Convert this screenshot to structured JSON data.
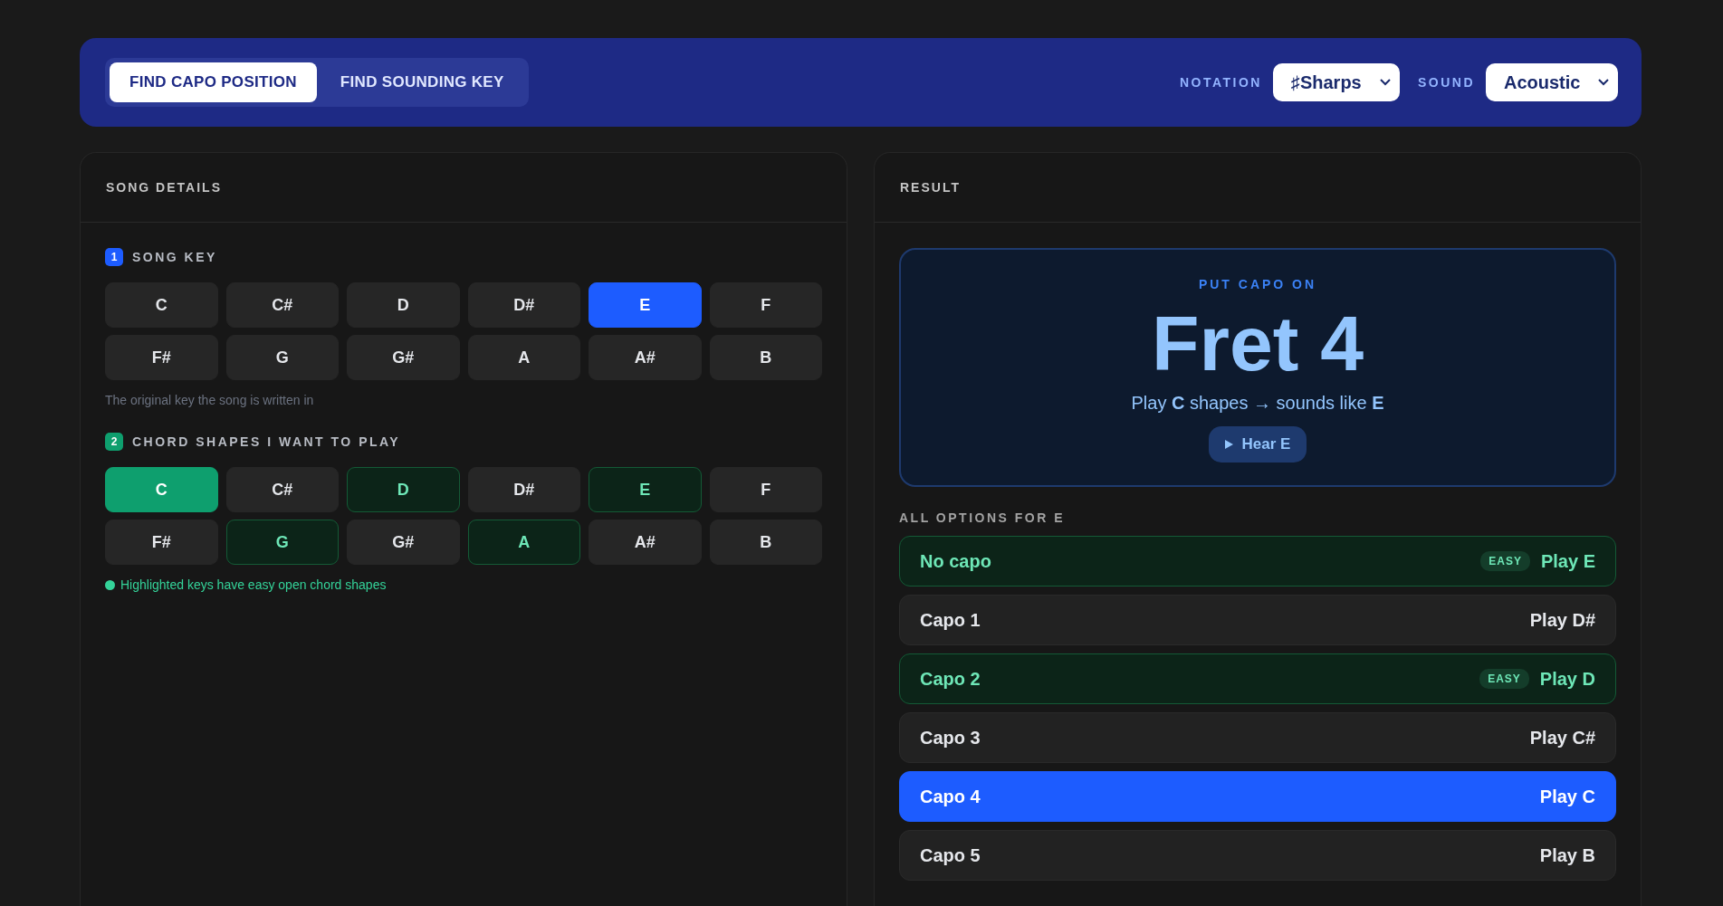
{
  "mode_tabs": [
    {
      "label": "FIND CAPO POSITION",
      "selected": true
    },
    {
      "label": "FIND SOUNDING KEY",
      "selected": false
    }
  ],
  "notation": {
    "label": "NOTATION",
    "value": "♯Sharps"
  },
  "sound": {
    "label": "SOUND",
    "value": "Acoustic"
  },
  "song_details": {
    "title": "SONG DETAILS",
    "song_key": {
      "step": "1",
      "label": "SONG KEY",
      "hint": "The original key the song is written in",
      "keys": [
        {
          "label": "C",
          "selected": false
        },
        {
          "label": "C#",
          "selected": false
        },
        {
          "label": "D",
          "selected": false
        },
        {
          "label": "D#",
          "selected": false
        },
        {
          "label": "E",
          "selected": true
        },
        {
          "label": "F",
          "selected": false
        },
        {
          "label": "F#",
          "selected": false
        },
        {
          "label": "G",
          "selected": false
        },
        {
          "label": "G#",
          "selected": false
        },
        {
          "label": "A",
          "selected": false
        },
        {
          "label": "A#",
          "selected": false
        },
        {
          "label": "B",
          "selected": false
        }
      ]
    },
    "chord_shapes": {
      "step": "2",
      "label": "CHORD SHAPES I WANT TO PLAY",
      "legend": "Highlighted keys have easy open chord shapes",
      "keys": [
        {
          "label": "C",
          "selected": true,
          "easy": true
        },
        {
          "label": "C#",
          "selected": false,
          "easy": false
        },
        {
          "label": "D",
          "selected": false,
          "easy": true
        },
        {
          "label": "D#",
          "selected": false,
          "easy": false
        },
        {
          "label": "E",
          "selected": false,
          "easy": true
        },
        {
          "label": "F",
          "selected": false,
          "easy": false
        },
        {
          "label": "F#",
          "selected": false,
          "easy": false
        },
        {
          "label": "G",
          "selected": false,
          "easy": true
        },
        {
          "label": "G#",
          "selected": false,
          "easy": false
        },
        {
          "label": "A",
          "selected": false,
          "easy": true
        },
        {
          "label": "A#",
          "selected": false,
          "easy": false
        },
        {
          "label": "B",
          "selected": false,
          "easy": false
        }
      ]
    }
  },
  "result": {
    "title": "RESULT",
    "card": {
      "eyebrow": "PUT CAPO ON",
      "headline": "Fret 4",
      "summary": "Play **C** shapes → sounds like **E**",
      "hear_button": "Hear E"
    },
    "options_title": "ALL OPTIONS FOR E",
    "options": [
      {
        "capo": "No capo",
        "play": "Play E",
        "easy": true,
        "badge": "EASY",
        "selected": false
      },
      {
        "capo": "Capo 1",
        "play": "Play D#",
        "easy": false,
        "selected": false
      },
      {
        "capo": "Capo 2",
        "play": "Play D",
        "easy": true,
        "badge": "EASY",
        "selected": false
      },
      {
        "capo": "Capo 3",
        "play": "Play C#",
        "easy": false,
        "selected": false
      },
      {
        "capo": "Capo 4",
        "play": "Play C",
        "easy": false,
        "selected": true
      },
      {
        "capo": "Capo 5",
        "play": "Play B",
        "easy": false,
        "selected": false
      }
    ]
  }
}
